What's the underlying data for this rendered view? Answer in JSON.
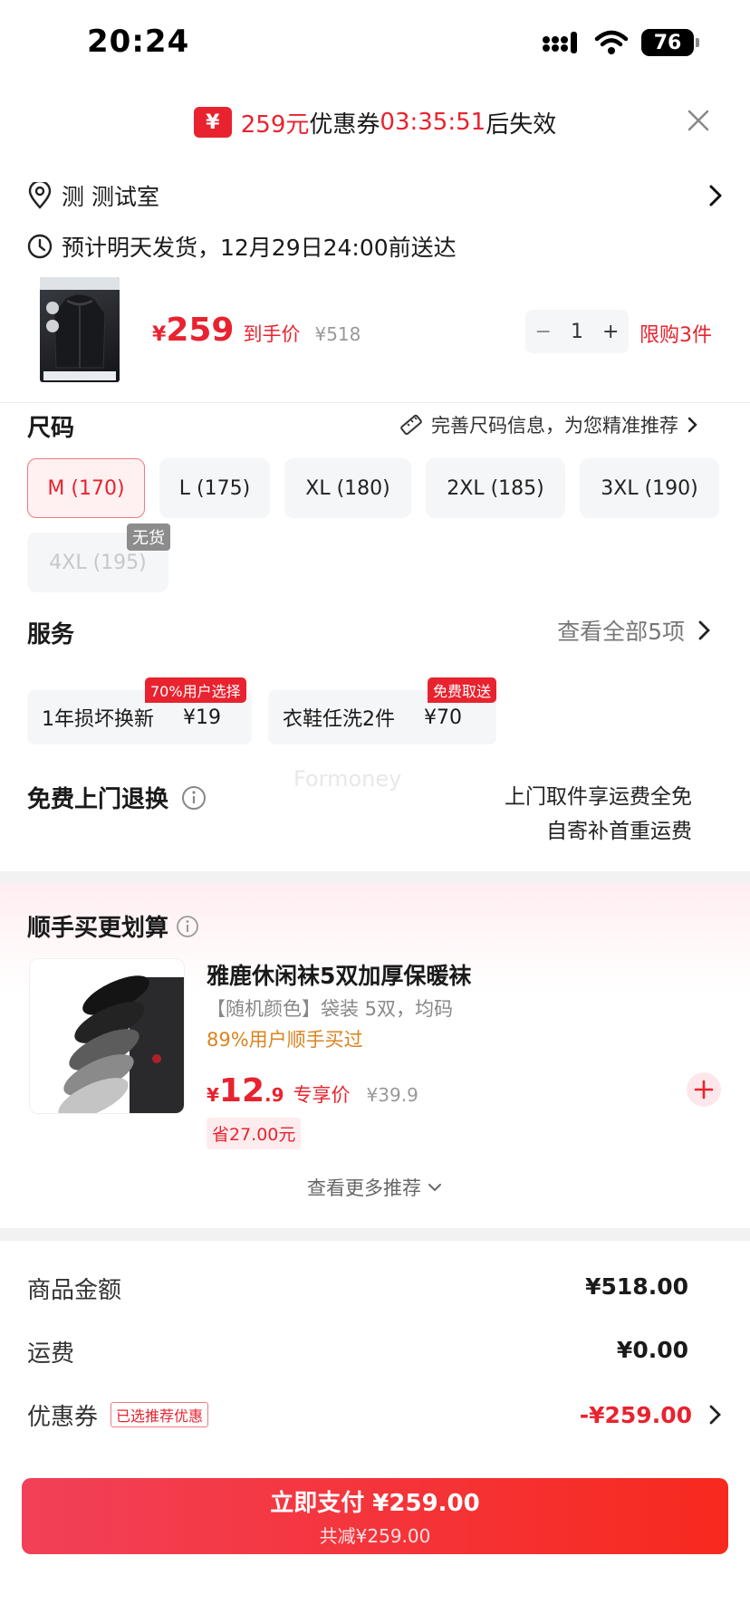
{
  "status_bar": {
    "time": "20:24",
    "battery": "76"
  },
  "banner": {
    "coupon_symbol": "¥",
    "amount": "259元",
    "coupon_text": "优惠券",
    "countdown": "03:35:51",
    "suffix": "后失效"
  },
  "address": {
    "text": "测 测试室"
  },
  "delivery": {
    "text": "预计明天发货，12月29日24:00前送达"
  },
  "product": {
    "price_symbol": "¥",
    "price": "259",
    "price_label": "到手价",
    "original_price": "¥518",
    "quantity": "1",
    "minus": "−",
    "plus": "+",
    "limit": "限购3件"
  },
  "size": {
    "title": "尺码",
    "hint": "完善尺码信息，为您精准推荐",
    "options": [
      "M (170)",
      "L (175)",
      "XL (180)",
      "2XL (185)",
      "3XL (190)",
      "4XL (195)"
    ],
    "selected": "M (170)",
    "out_of_stock_badge": "无货"
  },
  "service": {
    "title": "服务",
    "view_all": "查看全部5项",
    "cards": [
      {
        "name": "1年损坏换新",
        "price": "¥19",
        "tag": "70%用户选择"
      },
      {
        "name": "衣鞋任洗2件",
        "price": "¥70",
        "tag": "免费取送"
      }
    ]
  },
  "free_return": {
    "title": "免费上门退换",
    "line1": "上门取件享运费全免",
    "line2": "自寄补首重运费",
    "watermark": "Formoney"
  },
  "recommend": {
    "title": "顺手买更划算",
    "item": {
      "name": "雅鹿休闲袜5双加厚保暖袜",
      "spec": "【随机颜色】袋装 5双，均码",
      "social": "89%用户顺手买过",
      "price_symbol": "¥",
      "price_int": "12",
      "price_dec": ".9",
      "price_label": "专享价",
      "original_price": "¥39.9",
      "save": "省27.00元"
    },
    "more": "查看更多推荐"
  },
  "bill": {
    "rows": [
      {
        "label": "商品金额",
        "value": "¥518.00"
      },
      {
        "label": "运费",
        "value": "¥0.00"
      },
      {
        "label": "优惠券",
        "value": "-¥259.00",
        "badge": "已选推荐优惠"
      }
    ]
  },
  "pay_button": {
    "label": "立即支付 ¥259.00",
    "sub": "共减¥259.00"
  },
  "colors": {
    "accent": "#e8232f",
    "orange_text": "#d9831f"
  }
}
